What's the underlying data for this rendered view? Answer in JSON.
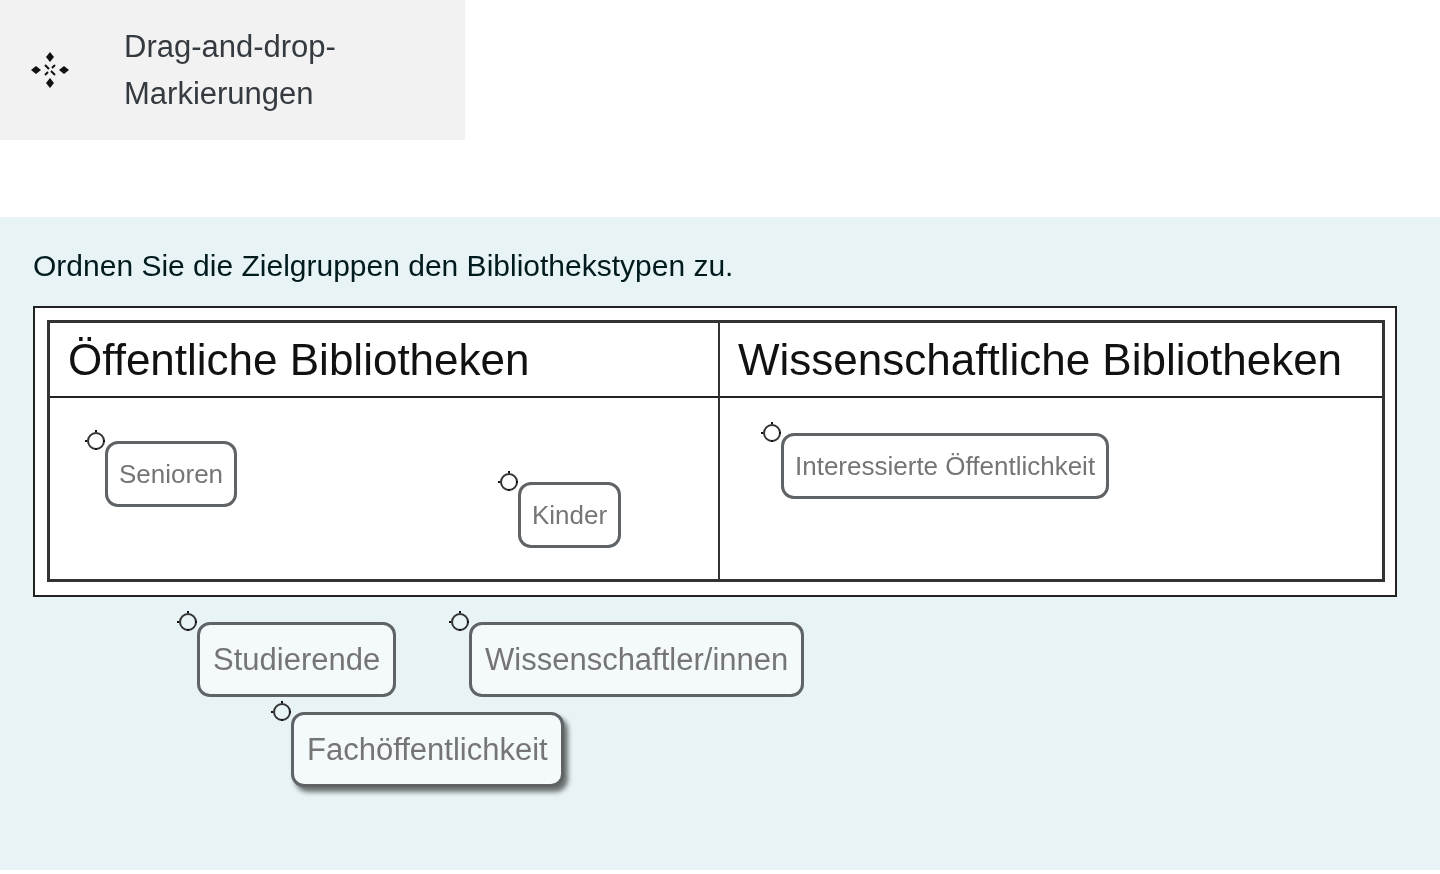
{
  "panel": {
    "title": "Drag-and-drop-Markierungen"
  },
  "question": {
    "text": "Ordnen Sie die Zielgruppen den Bibliothekstypen zu.",
    "image": {
      "columns": [
        {
          "heading": "Öffentliche Bibliotheken",
          "markers": [
            {
              "label": "Senioren",
              "dragging": false
            },
            {
              "label": "Kinder",
              "dragging": false
            }
          ]
        },
        {
          "heading": "Wissenschaftliche Bibliotheken",
          "markers": [
            {
              "label": "Interessierte Öffentlichkeit",
              "dragging": false
            }
          ]
        }
      ]
    },
    "tray": [
      {
        "label": "Studierende",
        "dragging": false
      },
      {
        "label": "Wissenschaftler/innen",
        "dragging": false
      },
      {
        "label": "Fachöffentlichkeit",
        "dragging": true
      }
    ]
  }
}
